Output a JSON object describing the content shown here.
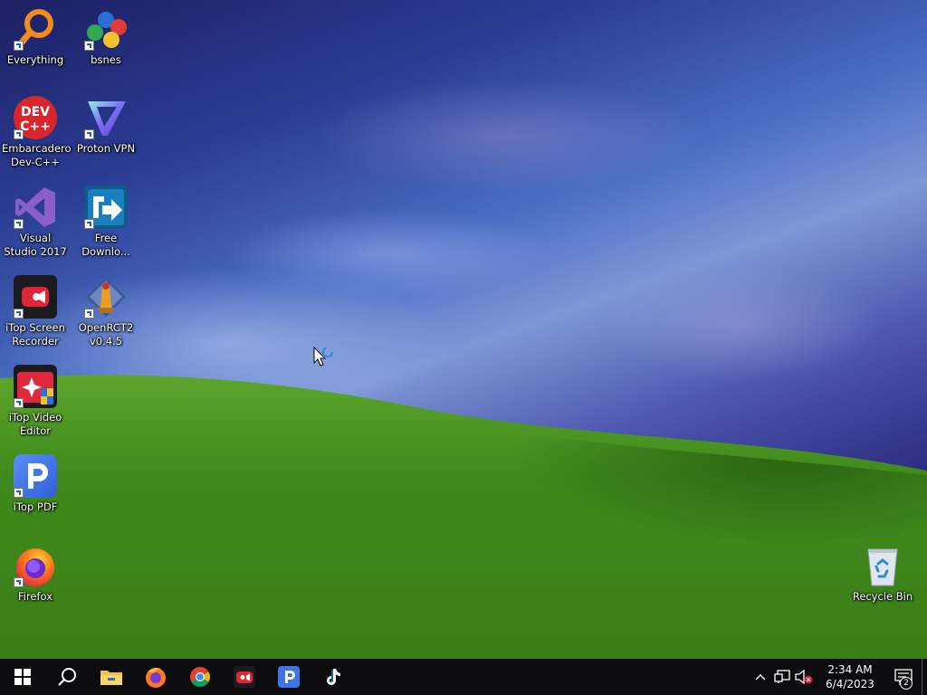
{
  "desktop": {
    "icons": [
      {
        "label": "Everything",
        "icon": "everything-search-icon"
      },
      {
        "label": "bsnes",
        "icon": "bsnes-icon"
      },
      {
        "label": "Embarcadero Dev-C++",
        "icon": "devcpp-icon",
        "badge_text": "DEV C++"
      },
      {
        "label": "Proton VPN",
        "icon": "protonvpn-icon"
      },
      {
        "label": "Visual Studio 2017",
        "icon": "visual-studio-icon"
      },
      {
        "label": "Free Downlo...",
        "icon": "free-download-manager-icon"
      },
      {
        "label": "iTop Screen Recorder",
        "icon": "itop-screen-recorder-icon"
      },
      {
        "label": "OpenRCT2 v0.4.5",
        "icon": "openrct2-icon"
      },
      {
        "label": "iTop Video Editor",
        "icon": "itop-video-editor-icon"
      },
      {
        "label": "iTop PDF",
        "icon": "itop-pdf-icon"
      },
      {
        "label": "Firefox",
        "icon": "firefox-icon"
      },
      {
        "label": "Recycle Bin",
        "icon": "recycle-bin-icon"
      }
    ]
  },
  "taskbar": {
    "buttons": [
      {
        "name": "start",
        "icon": "windows-logo-icon"
      },
      {
        "name": "search",
        "icon": "search-icon"
      },
      {
        "name": "file-explorer",
        "icon": "folder-icon"
      },
      {
        "name": "firefox",
        "icon": "firefox-icon"
      },
      {
        "name": "chrome",
        "icon": "chrome-icon"
      },
      {
        "name": "itop-screen-recorder",
        "icon": "itop-screen-recorder-icon"
      },
      {
        "name": "itop-pdf",
        "icon": "itop-pdf-icon"
      },
      {
        "name": "tiktok",
        "icon": "tiktok-icon"
      }
    ],
    "tray": {
      "icons": [
        "chevron-up-icon",
        "network-icon",
        "volume-muted-icon"
      ],
      "time": "2:34 AM",
      "date": "6/4/2023",
      "notification_count": "2"
    }
  },
  "colors": {
    "taskbar": "#0c0c0f",
    "sky_dark": "#1c1f63",
    "grass": "#3f8a1c"
  }
}
